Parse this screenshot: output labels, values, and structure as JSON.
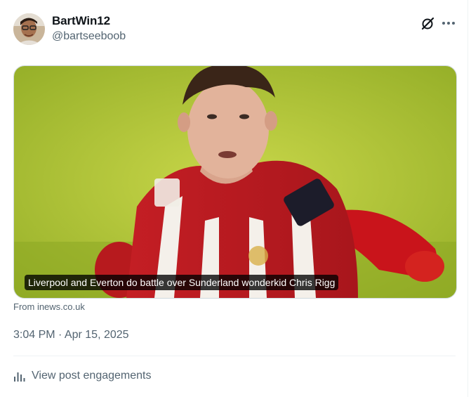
{
  "author": {
    "display_name": "BartWin12",
    "handle": "@bartseeboob",
    "avatar_icon": "user-avatar-photo"
  },
  "header_actions": {
    "grok_icon": "grok-icon",
    "more_icon": "more-dots-icon"
  },
  "link_card": {
    "title": "Liverpool and Everton do battle over Sunderland wonderkid Chris Rigg",
    "image_description_icon": "footballer-photo",
    "source": "From inews.co.uk"
  },
  "post_meta": {
    "timestamp": "3:04 PM · Apr 15, 2025"
  },
  "engagements": {
    "label": "View post engagements",
    "icon": "bar-chart-icon"
  },
  "colors": {
    "secondary_text": "#536471",
    "primary_text": "#0f1419",
    "border": "#cfd9de"
  }
}
